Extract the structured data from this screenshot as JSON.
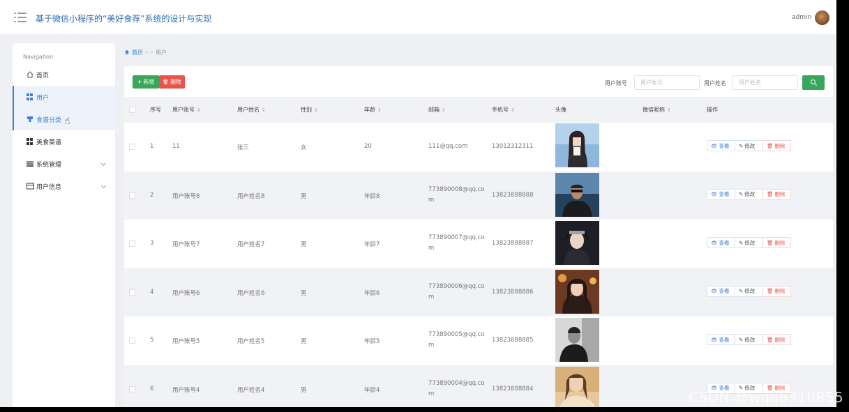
{
  "header": {
    "app_title": "基于微信小程序的“美好食荐”系统的设计与实现",
    "user_name": "admin"
  },
  "sidebar": {
    "caption": "Navigation",
    "items": [
      {
        "label": "首页",
        "icon": "home-icon"
      },
      {
        "label": "用户",
        "icon": "grid-icon"
      },
      {
        "label": "食谱分类",
        "icon": "grid-icon"
      },
      {
        "label": "美食菜谱",
        "icon": "grid-icon"
      },
      {
        "label": "系统管理",
        "icon": "list-icon"
      },
      {
        "label": "用户信息",
        "icon": "card-icon"
      }
    ]
  },
  "breadcrumb": {
    "home": "首页",
    "separator": "> >",
    "current": "用户"
  },
  "toolbar": {
    "add_label": "新增",
    "delete_label": "删除"
  },
  "search": {
    "account_label": "用户账号",
    "account_placeholder": "用户账号",
    "name_label": "用户姓名",
    "name_placeholder": "用户姓名"
  },
  "table": {
    "columns": [
      "序号",
      "用户账号",
      "用户姓名",
      "性别",
      "年龄",
      "邮箱",
      "手机号",
      "头像",
      "微信昵称",
      "操作"
    ],
    "rows": [
      {
        "no": "1",
        "account": "11",
        "name": "张三",
        "gender": "女",
        "age": "20",
        "email": "111@qq.com",
        "phone": "13012312311",
        "nickname": ""
      },
      {
        "no": "2",
        "account": "用户账号8",
        "name": "用户姓名8",
        "gender": "男",
        "age": "年龄8",
        "email": "773890008@qq.com",
        "phone": "13823888888",
        "nickname": ""
      },
      {
        "no": "3",
        "account": "用户账号7",
        "name": "用户姓名7",
        "gender": "男",
        "age": "年龄7",
        "email": "773890007@qq.com",
        "phone": "13823888887",
        "nickname": ""
      },
      {
        "no": "4",
        "account": "用户账号6",
        "name": "用户姓名6",
        "gender": "男",
        "age": "年龄6",
        "email": "773890006@qq.com",
        "phone": "13823888886",
        "nickname": ""
      },
      {
        "no": "5",
        "account": "用户账号5",
        "name": "用户姓名5",
        "gender": "男",
        "age": "年龄5",
        "email": "773890005@qq.com",
        "phone": "13823888885",
        "nickname": ""
      },
      {
        "no": "6",
        "account": "用户账号4",
        "name": "用户姓名4",
        "gender": "男",
        "age": "年龄4",
        "email": "773890004@qq.com",
        "phone": "13823888884",
        "nickname": ""
      }
    ],
    "actions": {
      "view": "查看",
      "edit": "修改",
      "delete": "删除"
    }
  },
  "watermark": "CSDN @wqq6310855",
  "colors": {
    "primary": "#3f7fd6",
    "success": "#3aa55b",
    "danger": "#e8534b",
    "title": "#2d6db5"
  }
}
